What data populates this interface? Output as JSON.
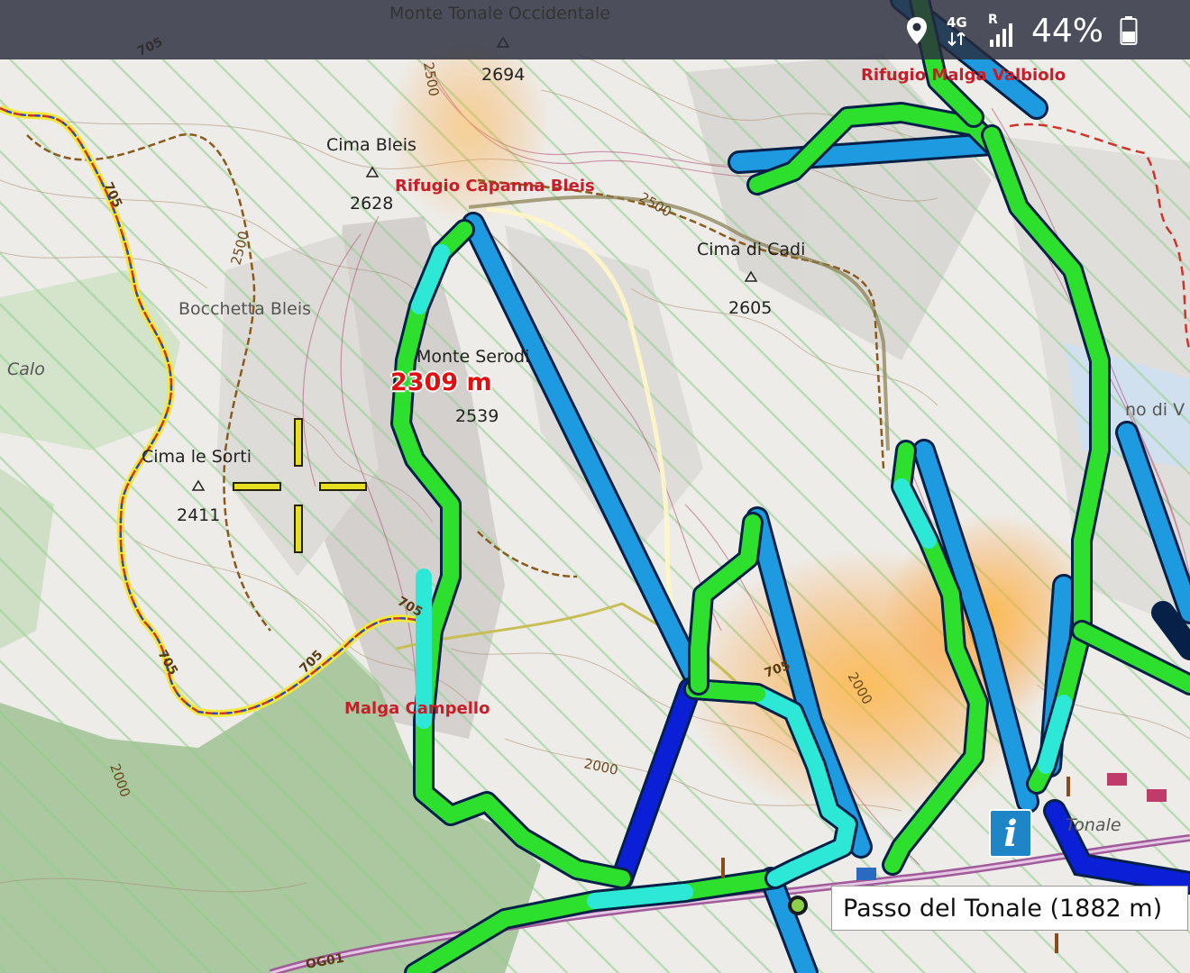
{
  "status_bar": {
    "top_place": "Monte Tonale Occidentale",
    "network": "4G",
    "roaming": "R",
    "battery": "44%",
    "icons": [
      "location-pin-icon",
      "network-4g-icon",
      "signal-icon",
      "battery-icon"
    ]
  },
  "peaks": [
    {
      "name": "Cima Bleis",
      "elevation": "2628"
    },
    {
      "name": "Cima di Cadi",
      "elevation": "2605"
    },
    {
      "name": "Monte Serodi",
      "elevation": "2539"
    },
    {
      "name": "Cima le Sorti",
      "elevation": "2411"
    },
    {
      "name": "",
      "elevation": "2694"
    }
  ],
  "pois": {
    "rifugio_capanna": "Rifugio Capanna Bleis",
    "rifugio_malga": "Rifugio Malga Valbiolo",
    "malga_campello": "Malga Campello"
  },
  "grey_labels": {
    "bocchetta": "Bocchetta Bleis",
    "calo": "Calo",
    "tonale": "Tonale",
    "lago": "no di V"
  },
  "contours": [
    "2500",
    "2500",
    "2500",
    "2000",
    "2000",
    "2000"
  ],
  "trails": [
    "705",
    "705",
    "705",
    "705",
    "705",
    "705",
    "OG01"
  ],
  "cursor_altitude": "2309 m",
  "place_callout": "Passo del Tonale (1882 m)",
  "info_button": "i",
  "colors": {
    "lift_blue": "#1e9be0",
    "lift_dark": "#0a1fd6",
    "slope_green": "#2ee02e",
    "slope_cyan": "#2de8d6",
    "status_bg": "#282c3c",
    "poi_red": "#c81e2a",
    "crosshair": "#e6e020"
  }
}
